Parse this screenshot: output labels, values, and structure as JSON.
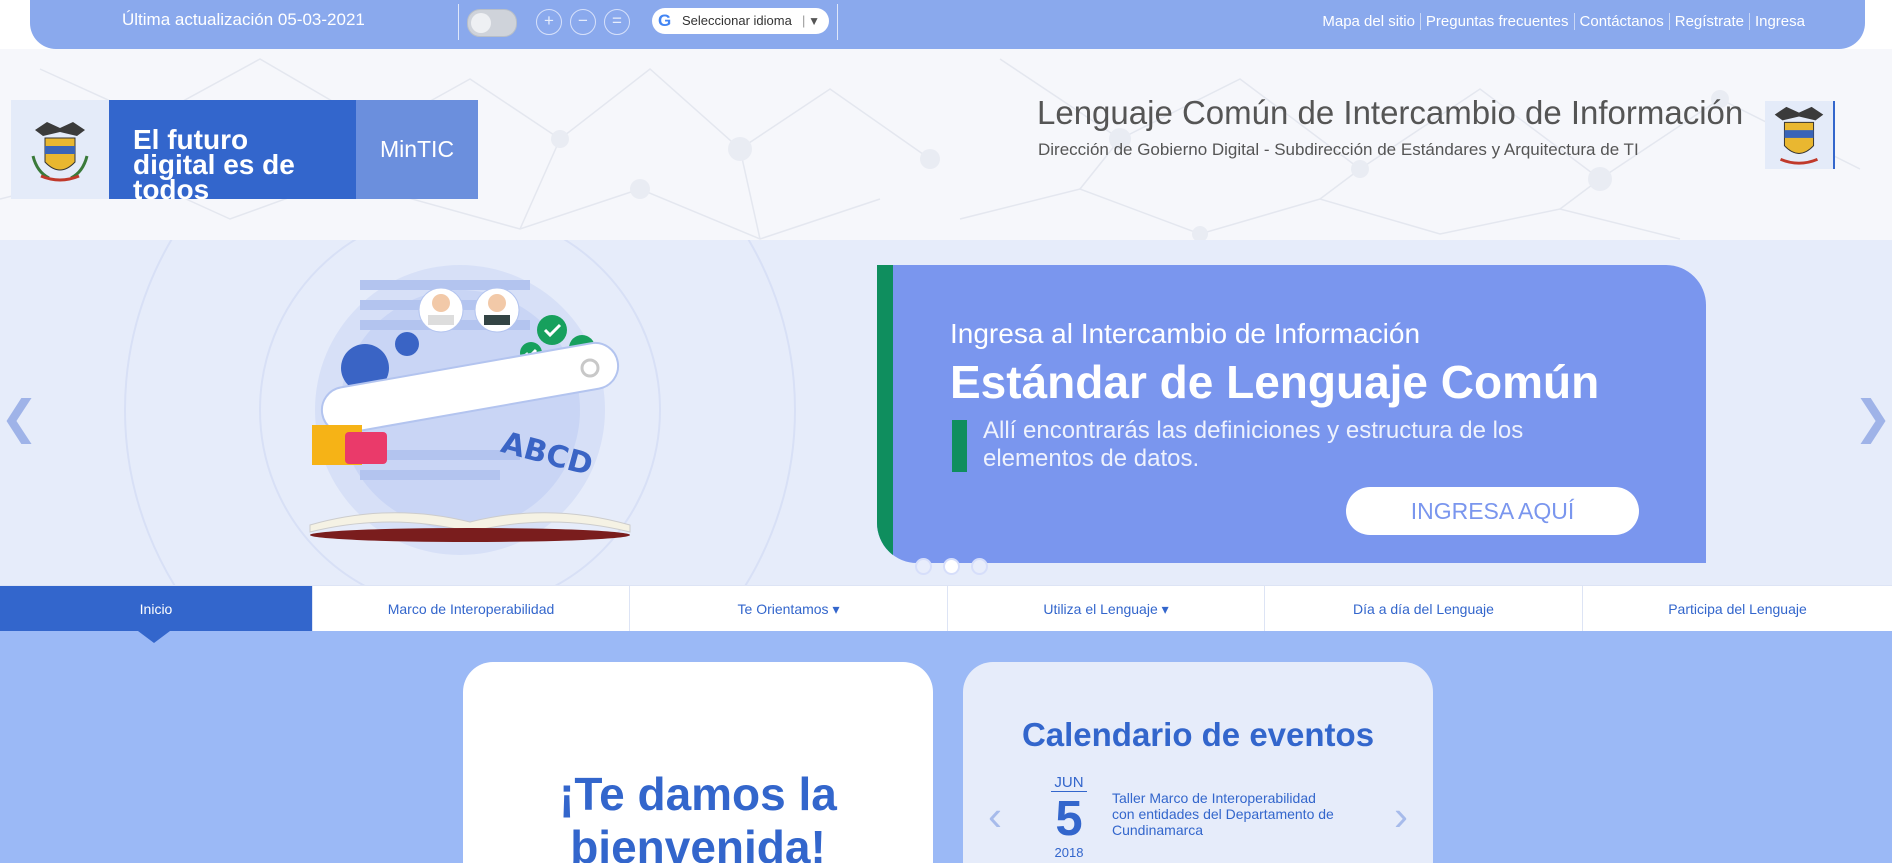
{
  "topbar": {
    "updated": "Última actualización 05-03-2021",
    "zoom_in": "+",
    "zoom_out": "−",
    "zoom_reset": "=",
    "language": {
      "g_label": "G",
      "label": "Seleccionar idioma",
      "separator": "|",
      "arrow": "▼"
    },
    "links": [
      "Mapa del sitio",
      "Preguntas frecuentes",
      "Contáctanos",
      "Regístrate",
      "Ingresa"
    ]
  },
  "header": {
    "logo_text": "El futuro digital es de todos",
    "logo_ministry": "MinTIC",
    "title": "Lenguaje Común de Intercambio de Información",
    "subtitle": "Dirección de Gobierno Digital - Subdirección de Estándares y Arquitectura de TI"
  },
  "carousel": {
    "kicker": "Ingresa al Intercambio de Información",
    "headline": "Estándar de Lenguaje Común",
    "description": "Allí encontrarás las definiciones y estructura de los elementos de datos.",
    "button": "INGRESA AQUÍ",
    "illustration_text": "ABCD",
    "prev": "❮",
    "next": "❯",
    "slides": 3,
    "active_slide": 2
  },
  "nav": {
    "items": [
      {
        "label": "Inicio"
      },
      {
        "label": "Marco de Interoperabilidad"
      },
      {
        "label": "Te Orientamos ▾"
      },
      {
        "label": "Utiliza el Lenguaje ▾"
      },
      {
        "label": "Día a día del Lenguaje"
      },
      {
        "label": "Participa del Lenguaje"
      }
    ],
    "active": 0
  },
  "main": {
    "welcome": "¡Te damos la bienvenida!",
    "calendar": {
      "title": "Calendario de eventos",
      "prev": "‹",
      "next": "›",
      "month": "JUN",
      "day": "5",
      "year": "2018",
      "event": "Taller Marco de Interoperabilidad con entidades del Departamento de Cundinamarca"
    }
  },
  "colors": {
    "primary": "#3366cc",
    "topbar": "#8aa9ed",
    "banner_card": "#7a96ee",
    "accent_green": "#0f8e5e",
    "main_bg": "#9bb9f6"
  }
}
